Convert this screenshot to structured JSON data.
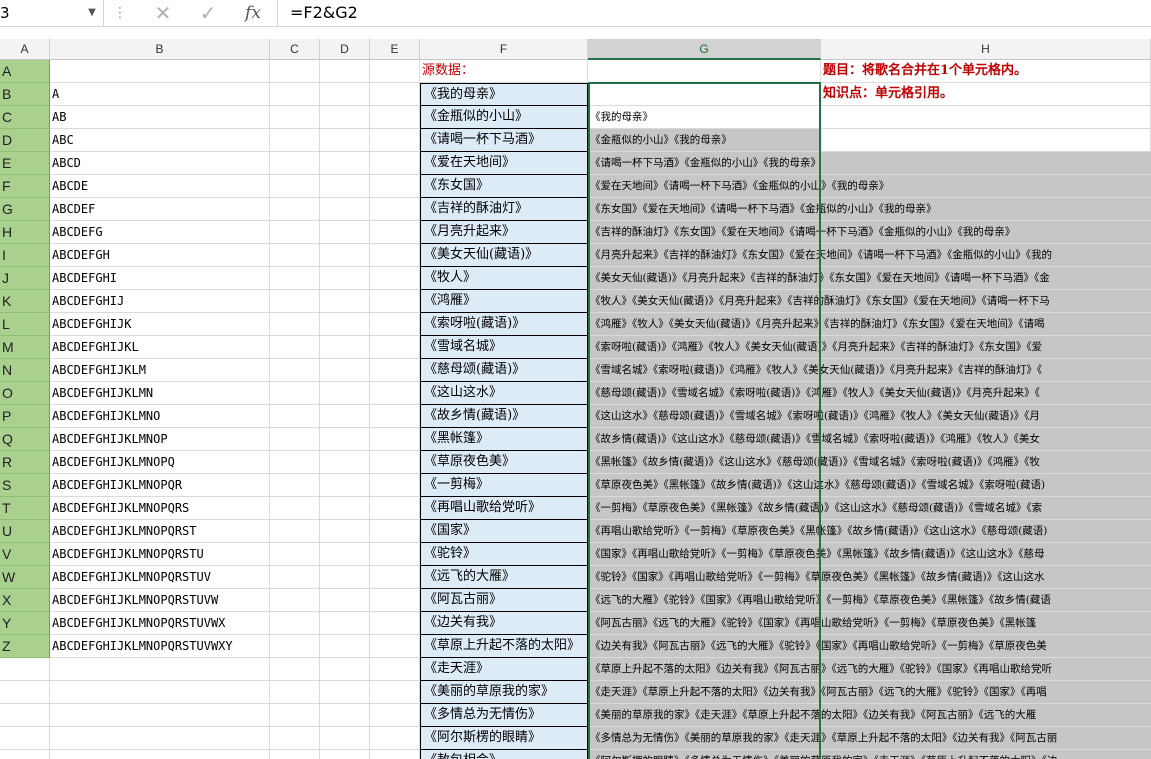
{
  "formula_bar": {
    "name_box": "3",
    "cancel_icon": "✕",
    "enter_icon": "✓",
    "fx_label": "fx",
    "formula": "=F2&G2"
  },
  "columns": [
    "A",
    "B",
    "C",
    "D",
    "E",
    "F",
    "G",
    "H"
  ],
  "rows": [
    {
      "a": "A",
      "b": "",
      "f": "源数据：",
      "g": "",
      "h": "题目：将歌名合并在1个单元格内。"
    },
    {
      "a": "B",
      "b": "A",
      "f": "《我的母亲》",
      "g": "",
      "h": "知识点：单元格引用。"
    },
    {
      "a": "C",
      "b": "AB",
      "f": "《金瓶似的小山》",
      "g": "《我的母亲》",
      "h": ""
    },
    {
      "a": "D",
      "b": "ABC",
      "f": "《请喝一杯下马酒》",
      "g": "《金瓶似的小山》《我的母亲》",
      "h": ""
    },
    {
      "a": "E",
      "b": "ABCD",
      "f": "《爱在天地间》",
      "g": "《请喝一杯下马酒》《金瓶似的小山》《我的母亲》",
      "h": ""
    },
    {
      "a": "F",
      "b": "ABCDE",
      "f": "《东女国》",
      "g": "《爱在天地间》《请喝一杯下马酒》《金瓶似的小山》《我的母亲》",
      "h": ""
    },
    {
      "a": "G",
      "b": "ABCDEF",
      "f": "《吉祥的酥油灯》",
      "g": "《东女国》《爱在天地间》《请喝一杯下马酒》《金瓶似的小山》《我的母亲》",
      "h": ""
    },
    {
      "a": "H",
      "b": "ABCDEFG",
      "f": "《月亮升起来》",
      "g": "《吉祥的酥油灯》《东女国》《爱在天地间》《请喝一杯下马酒》《金瓶似的小山》《我的母亲》",
      "h": ""
    },
    {
      "a": "I",
      "b": "ABCDEFGH",
      "f": "《美女天仙(藏语)》",
      "g": "《月亮升起来》《吉祥的酥油灯》《东女国》《爱在天地间》《请喝一杯下马酒》《金瓶似的小山》《我的",
      "h": ""
    },
    {
      "a": "J",
      "b": "ABCDEFGHI",
      "f": "《牧人》",
      "g": "《美女天仙(藏语)》《月亮升起来》《吉祥的酥油灯》《东女国》《爱在天地间》《请喝一杯下马酒》《金",
      "h": ""
    },
    {
      "a": "K",
      "b": "ABCDEFGHIJ",
      "f": "《鸿雁》",
      "g": "《牧人》《美女天仙(藏语)》《月亮升起来》《吉祥的酥油灯》《东女国》《爱在天地间》《请喝一杯下马",
      "h": ""
    },
    {
      "a": "L",
      "b": "ABCDEFGHIJK",
      "f": "《索呀啦(藏语)》",
      "g": "《鸿雁》《牧人》《美女天仙(藏语)》《月亮升起来》《吉祥的酥油灯》《东女国》《爱在天地间》《请喝",
      "h": ""
    },
    {
      "a": "M",
      "b": "ABCDEFGHIJKL",
      "f": "《雪域名城》",
      "g": "《索呀啦(藏语)》《鸿雁》《牧人》《美女天仙(藏语)》《月亮升起来》《吉祥的酥油灯》《东女国》《爱",
      "h": ""
    },
    {
      "a": "N",
      "b": "ABCDEFGHIJKLM",
      "f": "《慈母颂(藏语)》",
      "g": "《雪域名城》《索呀啦(藏语)》《鸿雁》《牧人》《美女天仙(藏语)》《月亮升起来》《吉祥的酥油灯》《",
      "h": ""
    },
    {
      "a": "O",
      "b": "ABCDEFGHIJKLMN",
      "f": "《这山这水》",
      "g": "《慈母颂(藏语)》《雪域名城》《索呀啦(藏语)》《鸿雁》《牧人》《美女天仙(藏语)》《月亮升起来》《",
      "h": ""
    },
    {
      "a": "P",
      "b": "ABCDEFGHIJKLMNO",
      "f": "《故乡情(藏语)》",
      "g": "《这山这水》《慈母颂(藏语)》《雪域名城》《索呀啦(藏语)》《鸿雁》《牧人》《美女天仙(藏语)》《月",
      "h": ""
    },
    {
      "a": "Q",
      "b": "ABCDEFGHIJKLMNOP",
      "f": "《黑帐篷》",
      "g": "《故乡情(藏语)》《这山这水》《慈母颂(藏语)》《雪域名城》《索呀啦(藏语)》《鸿雁》《牧人》《美女",
      "h": ""
    },
    {
      "a": "R",
      "b": "ABCDEFGHIJKLMNOPQ",
      "f": "《草原夜色美》",
      "g": "《黑帐篷》《故乡情(藏语)》《这山这水》《慈母颂(藏语)》《雪域名城》《索呀啦(藏语)》《鸿雁》《牧",
      "h": ""
    },
    {
      "a": "S",
      "b": "ABCDEFGHIJKLMNOPQR",
      "f": "《一剪梅》",
      "g": "《草原夜色美》《黑帐篷》《故乡情(藏语)》《这山这水》《慈母颂(藏语)》《雪域名城》《索呀啦(藏语)",
      "h": ""
    },
    {
      "a": "T",
      "b": "ABCDEFGHIJKLMNOPQRS",
      "f": "《再唱山歌给党听》",
      "g": "《一剪梅》《草原夜色美》《黑帐篷》《故乡情(藏语)》《这山这水》《慈母颂(藏语)》《雪域名城》《索",
      "h": ""
    },
    {
      "a": "U",
      "b": "ABCDEFGHIJKLMNOPQRST",
      "f": "《国家》",
      "g": "《再唱山歌给党听》《一剪梅》《草原夜色美》《黑帐篷》《故乡情(藏语)》《这山这水》《慈母颂(藏语)",
      "h": ""
    },
    {
      "a": "V",
      "b": "ABCDEFGHIJKLMNOPQRSTU",
      "f": "《驼铃》",
      "g": "《国家》《再唱山歌给党听》《一剪梅》《草原夜色美》《黑帐篷》《故乡情(藏语)》《这山这水》《慈母",
      "h": ""
    },
    {
      "a": "W",
      "b": "ABCDEFGHIJKLMNOPQRSTUV",
      "f": "《远飞的大雁》",
      "g": "《驼铃》《国家》《再唱山歌给党听》《一剪梅》《草原夜色美》《黑帐篷》《故乡情(藏语)》《这山这水",
      "h": ""
    },
    {
      "a": "X",
      "b": "ABCDEFGHIJKLMNOPQRSTUVW",
      "f": "《阿瓦古丽》",
      "g": "《远飞的大雁》《驼铃》《国家》《再唱山歌给党听》《一剪梅》《草原夜色美》《黑帐篷》《故乡情(藏语",
      "h": ""
    },
    {
      "a": "Y",
      "b": "ABCDEFGHIJKLMNOPQRSTUVWX",
      "f": "《边关有我》",
      "g": "《阿瓦古丽》《远飞的大雁》《驼铃》《国家》《再唱山歌给党听》《一剪梅》《草原夜色美》《黑帐篷",
      "h": ""
    },
    {
      "a": "Z",
      "b": "ABCDEFGHIJKLMNOPQRSTUVWXY",
      "f": "《草原上升起不落的太阳》",
      "g": "《边关有我》《阿瓦古丽》《远飞的大雁》《驼铃》《国家》《再唱山歌给党听》《一剪梅》《草原夜色美",
      "h": ""
    },
    {
      "a": "",
      "b": "",
      "f": "《走天涯》",
      "g": "《草原上升起不落的太阳》《边关有我》《阿瓦古丽》《远飞的大雁》《驼铃》《国家》《再唱山歌给党听",
      "h": ""
    },
    {
      "a": "",
      "b": "",
      "f": "《美丽的草原我的家》",
      "g": "《走天涯》《草原上升起不落的太阳》《边关有我》《阿瓦古丽》《远飞的大雁》《驼铃》《国家》《再唱",
      "h": ""
    },
    {
      "a": "",
      "b": "",
      "f": "《多情总为无情伤》",
      "g": "《美丽的草原我的家》《走天涯》《草原上升起不落的太阳》《边关有我》《阿瓦古丽》《远飞的大雁",
      "h": ""
    },
    {
      "a": "",
      "b": "",
      "f": "《阿尔斯楞的眼睛》",
      "g": "《多情总为无情伤》《美丽的草原我的家》《走天涯》《草原上升起不落的太阳》《边关有我》《阿瓦古丽",
      "h": ""
    },
    {
      "a": "",
      "b": "",
      "f": "《敖包相会》",
      "g": "《阿尔斯楞的眼睛》《多情总为无情伤》《美丽的草原我的家》《走天涯》《草原上升起不落的太阳》《边",
      "h": ""
    }
  ]
}
